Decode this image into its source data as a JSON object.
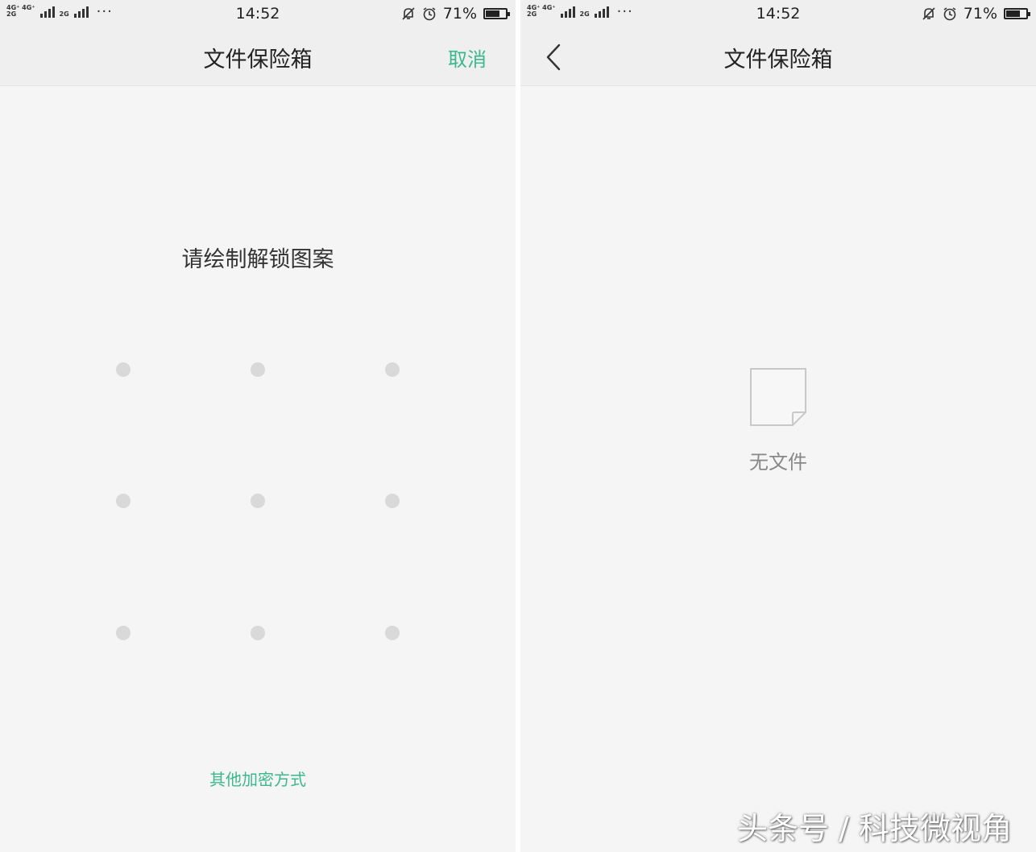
{
  "status": {
    "network_top": "4G⁺ 4G⁺",
    "network_bottom": "2G",
    "network_extra": "2G",
    "time": "14:52",
    "battery": "71%",
    "battery_level": 0.71,
    "more": "···"
  },
  "left": {
    "title": "文件保险箱",
    "cancel": "取消",
    "prompt": "请绘制解锁图案",
    "pattern_dot_count": 9,
    "other_methods": "其他加密方式"
  },
  "right": {
    "title": "文件保险箱",
    "back_icon": "chevron-left-icon",
    "empty_icon": "blank-document-icon",
    "empty_text": "无文件"
  },
  "watermark": "头条号 / 科技微视角",
  "colors": {
    "accent": "#3cb88f",
    "background": "#f5f5f5",
    "bar": "#efefef",
    "pattern_dot": "#d9d9d9"
  }
}
